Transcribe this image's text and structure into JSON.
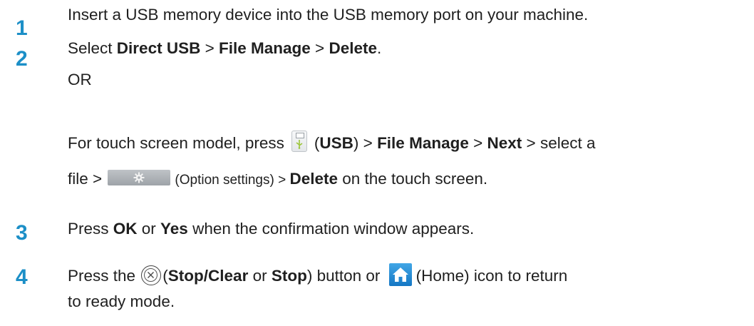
{
  "colors": {
    "step_number": "#1c8fc7",
    "text": "#1f1f1f",
    "home_icon": "#1f87d0"
  },
  "steps": [
    {
      "number": "1",
      "text": "Insert a USB memory device into the USB memory port on your machine."
    },
    {
      "number": "2",
      "parts": [
        "Select ",
        "Direct USB",
        " > ",
        "File Manage",
        " > ",
        "Delete",
        "."
      ]
    },
    {
      "number": "3",
      "parts": [
        "Press ",
        "OK",
        " or ",
        "Yes",
        " when the confirmation window appears."
      ]
    },
    {
      "number": "4",
      "parts": [
        "Press the ",
        "(",
        "Stop/Clear",
        " or ",
        "Stop",
        ") button or ",
        "(Home) icon to return",
        "to ready mode."
      ]
    }
  ],
  "or_text": "OR",
  "touch": {
    "prefix": "For touch screen model, press",
    "paren_open": "(",
    "usb": "USB",
    "paren_close": ")",
    "sep1": " > ",
    "file_manage": "File Manage",
    "sep2": " > ",
    "next": "Next",
    "suffix1": " > select a",
    "file": "file > ",
    "option_settings": "(Option settings) > ",
    "delete": "Delete",
    "suffix2": " on the touch screen."
  },
  "icons": {
    "usb": "usb-icon",
    "option": "gear-icon",
    "stop": "stop-icon",
    "home": "home-icon"
  }
}
